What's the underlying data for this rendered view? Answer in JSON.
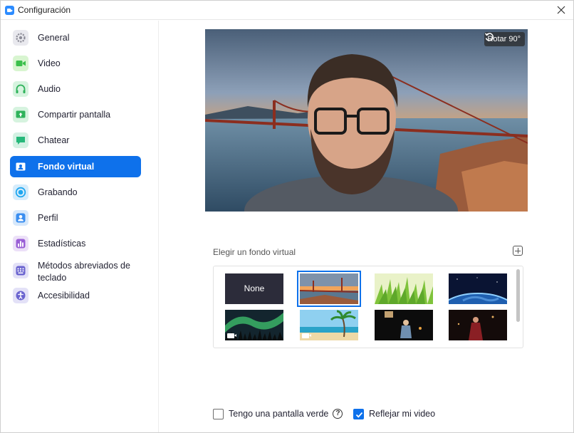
{
  "window": {
    "title": "Configuración",
    "close_icon": "close-icon"
  },
  "sidebar": {
    "items": [
      {
        "label": "General",
        "icon": "gear-icon",
        "color": "#e9e9ee",
        "active": false
      },
      {
        "label": "Video",
        "icon": "video-camera-icon",
        "color": "#d8f5d0",
        "active": false
      },
      {
        "label": "Audio",
        "icon": "headphones-icon",
        "color": "#d6f3df",
        "active": false
      },
      {
        "label": "Compartir pantalla",
        "icon": "share-screen-icon",
        "color": "#d6f3df",
        "active": false
      },
      {
        "label": "Chatear",
        "icon": "chat-bubble-icon",
        "color": "#d3f1e3",
        "active": false
      },
      {
        "label": "Fondo virtual",
        "icon": "virtual-background-icon",
        "color": "#0e71eb",
        "active": true
      },
      {
        "label": "Grabando",
        "icon": "record-icon",
        "color": "#d6ecfb",
        "active": false
      },
      {
        "label": "Perfil",
        "icon": "person-icon",
        "color": "#d6e8fb",
        "active": false
      },
      {
        "label": "Estadísticas",
        "icon": "bar-chart-icon",
        "color": "#ece0f8",
        "active": false
      },
      {
        "label": "Métodos abreviados de teclado",
        "icon": "keyboard-icon",
        "color": "#e3e1f7",
        "active": false
      },
      {
        "label": "Accesibilidad",
        "icon": "accessibility-icon",
        "color": "#e3e1f7",
        "active": false
      }
    ]
  },
  "preview": {
    "rotate_label": "Rotar 90°",
    "rotate_icon": "rotate-icon"
  },
  "backgrounds": {
    "heading": "Elegir un fondo virtual",
    "add_icon": "add-icon",
    "items": [
      {
        "label": "None",
        "kind": "none",
        "selected": false,
        "video": false
      },
      {
        "label": "",
        "kind": "golden-gate",
        "selected": true,
        "video": false
      },
      {
        "label": "",
        "kind": "grass",
        "selected": false,
        "video": false
      },
      {
        "label": "",
        "kind": "earth-from-space",
        "selected": false,
        "video": false
      },
      {
        "label": "",
        "kind": "aurora",
        "selected": false,
        "video": true
      },
      {
        "label": "",
        "kind": "beach",
        "selected": false,
        "video": true
      },
      {
        "label": "",
        "kind": "dark-scene-1",
        "selected": false,
        "video": false
      },
      {
        "label": "",
        "kind": "dark-scene-2",
        "selected": false,
        "video": false
      }
    ]
  },
  "options": {
    "green_screen_label": "Tengo una pantalla verde",
    "green_screen_checked": false,
    "mirror_label": "Reflejar mi video",
    "mirror_checked": true
  },
  "colors": {
    "accent": "#0e71eb"
  }
}
